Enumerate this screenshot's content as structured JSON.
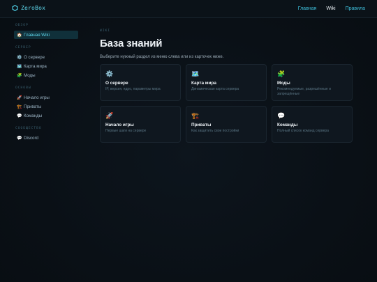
{
  "header": {
    "brand": "ZeroBox",
    "nav": [
      {
        "label": "Главная"
      },
      {
        "label": "Wiki"
      },
      {
        "label": "Правила"
      }
    ]
  },
  "sidebar": {
    "sections": [
      {
        "heading": "ОБЗОР",
        "items": [
          {
            "emoji": "🏠",
            "label": "Главная Wiki"
          }
        ]
      },
      {
        "heading": "СЕРВЕР",
        "items": [
          {
            "emoji": "⚙️",
            "label": "О сервере"
          },
          {
            "emoji": "🗺️",
            "label": "Карта мира"
          },
          {
            "emoji": "🧩",
            "label": "Моды"
          }
        ]
      },
      {
        "heading": "ОСНОВЫ",
        "items": [
          {
            "emoji": "🚀",
            "label": "Начало игры"
          },
          {
            "emoji": "🏗️",
            "label": "Приваты"
          },
          {
            "emoji": "💬",
            "label": "Команды"
          }
        ]
      },
      {
        "heading": "СООБЩЕСТВО",
        "items": [
          {
            "emoji": "💬",
            "label": "Discord"
          }
        ]
      }
    ]
  },
  "main": {
    "kicker": "WIKI",
    "title": "База знаний",
    "subtitle": "Выберите нужный раздел из меню слева или из карточек ниже.",
    "cards": [
      {
        "emoji": "⚙️",
        "title": "О сервере",
        "desc": "IP, версия, ядро, параметры мира"
      },
      {
        "emoji": "🗺️",
        "title": "Карта мира",
        "desc": "Динамическая карта сервера"
      },
      {
        "emoji": "🧩",
        "title": "Моды",
        "desc": "Рекомендуемые, разрешённые и запрещённые"
      },
      {
        "emoji": "🚀",
        "title": "Начало игры",
        "desc": "Первые шаги на сервере"
      },
      {
        "emoji": "🏗️",
        "title": "Приваты",
        "desc": "Как защитить свои постройки"
      },
      {
        "emoji": "💬",
        "title": "Команды",
        "desc": "Полный список команд сервера"
      }
    ]
  },
  "colors": {
    "accent": "#5fd9ee",
    "background": "#0a1016",
    "card": "#0f171f",
    "active_item_bg": "#10303a"
  }
}
